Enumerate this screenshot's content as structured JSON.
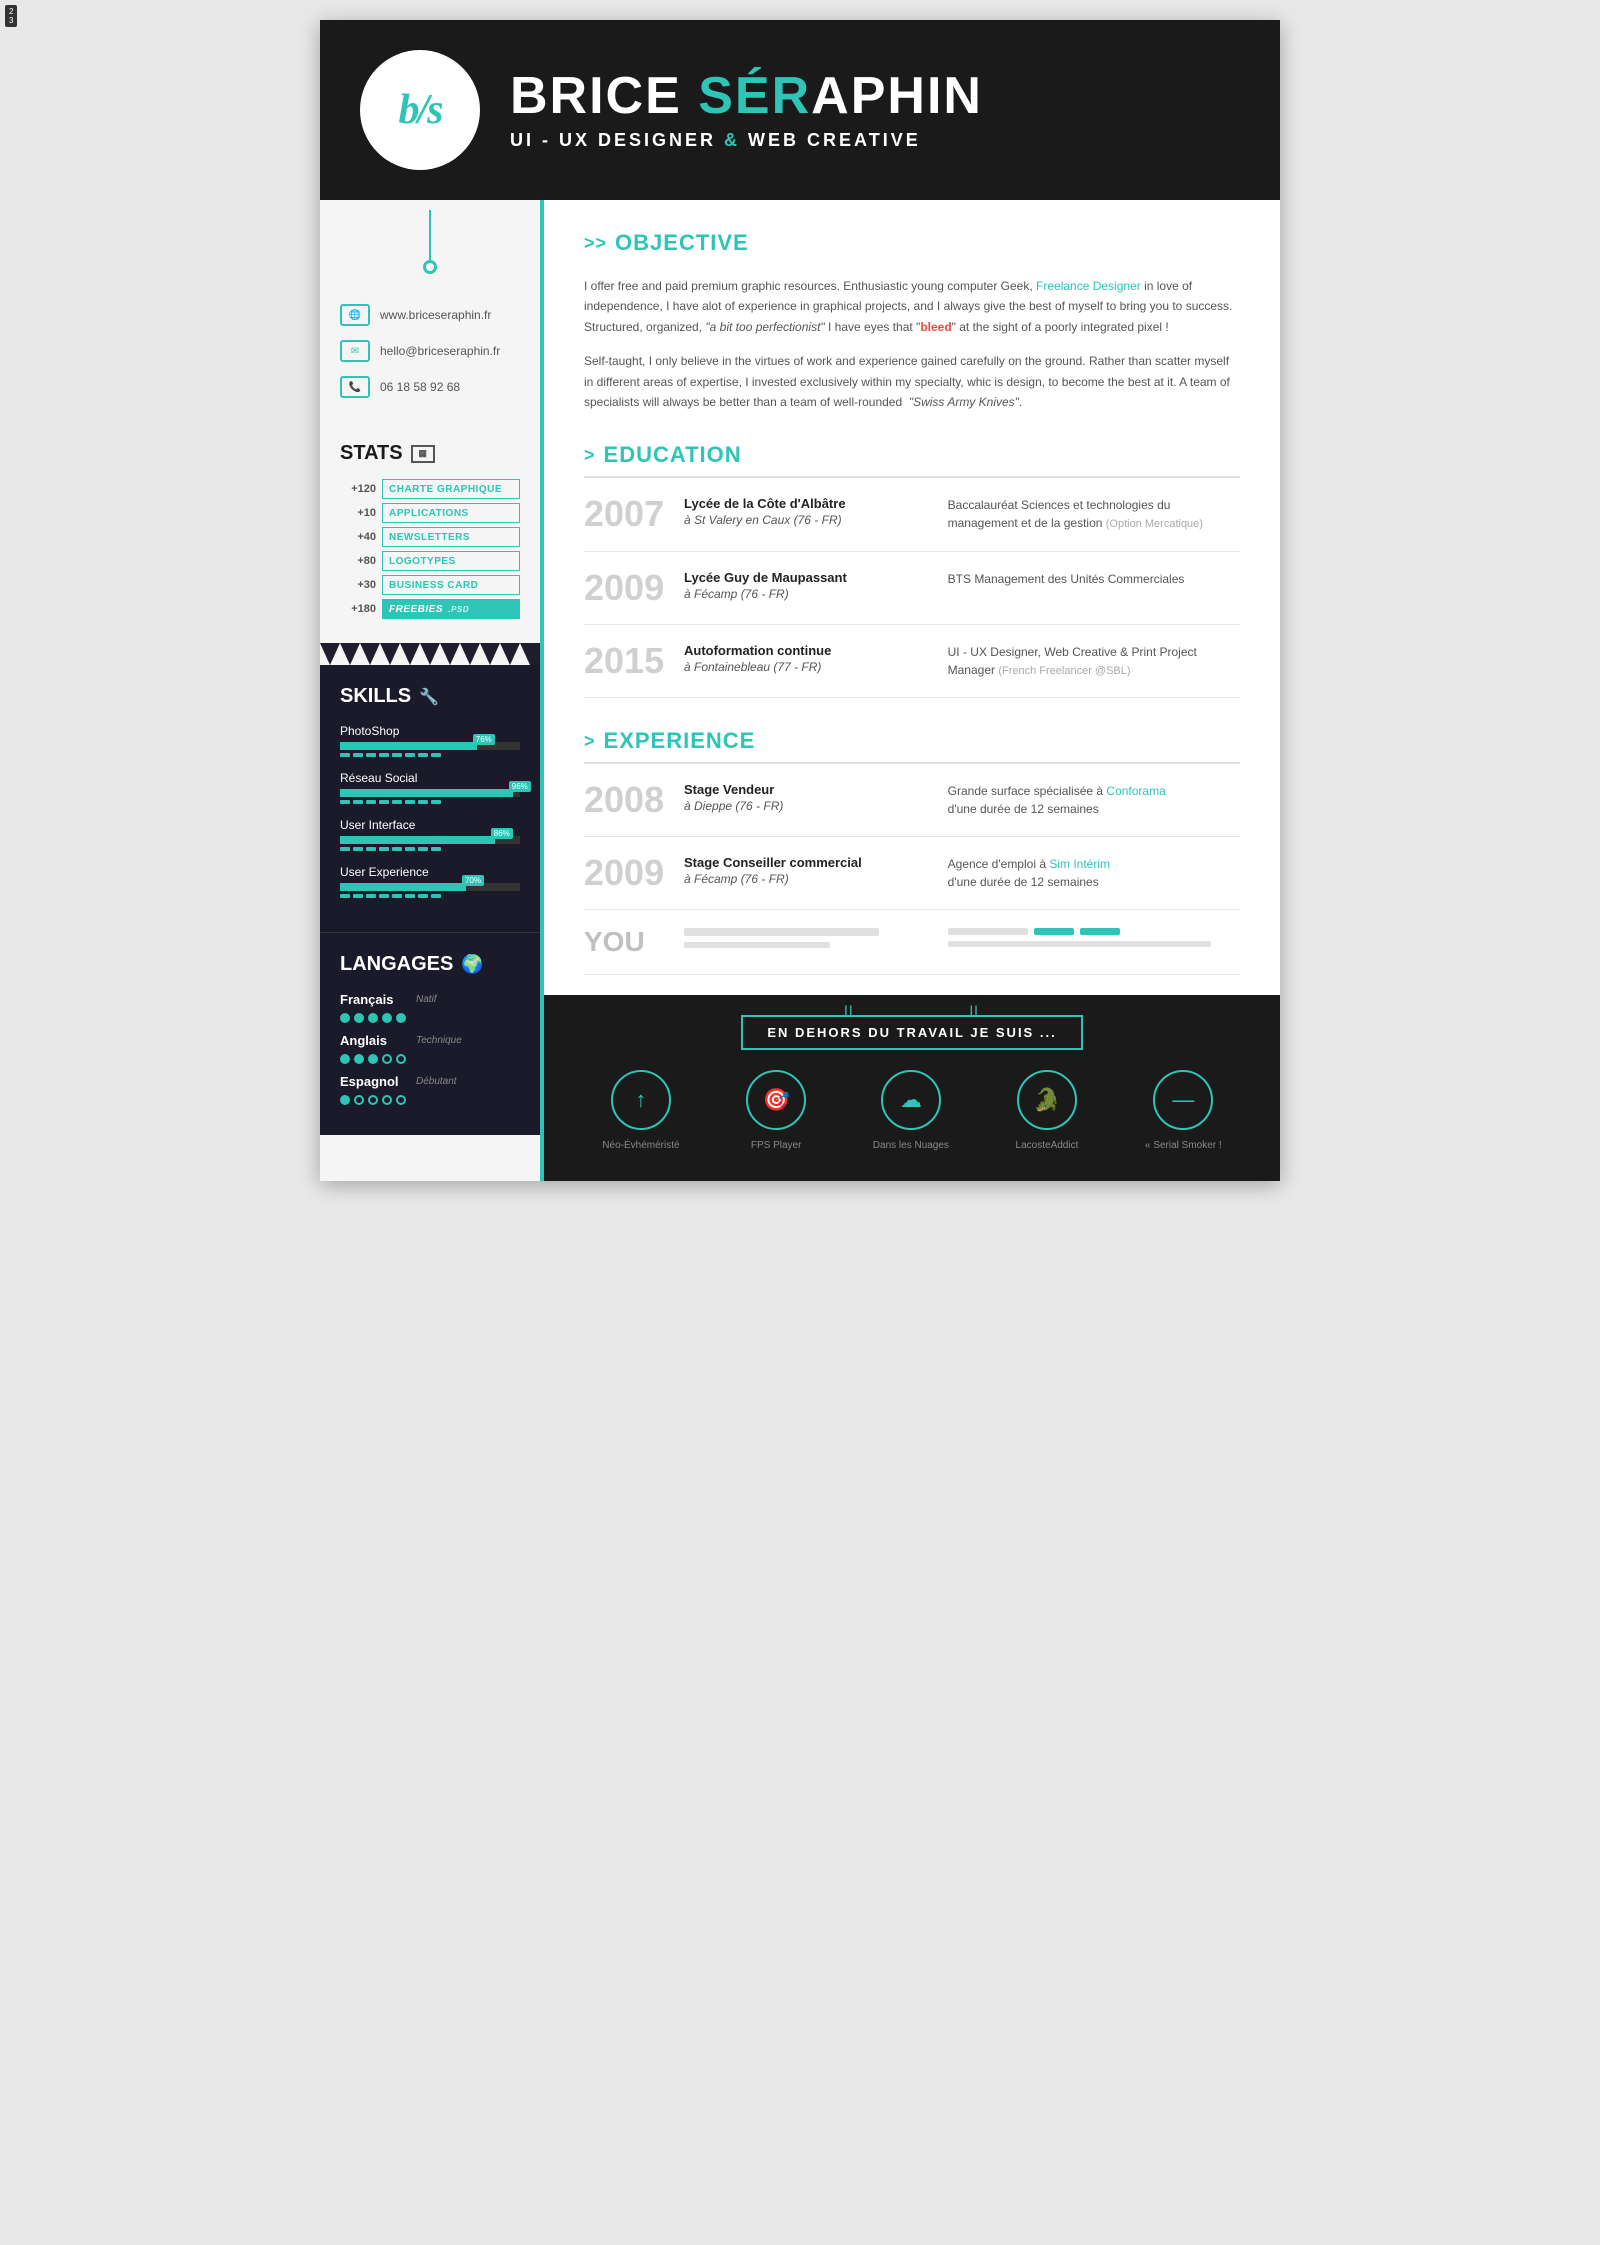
{
  "page": {
    "indicator": "2\n3"
  },
  "header": {
    "logo": "b/s",
    "name_part1": "BRICE ",
    "name_part2_teal": "SÉR",
    "name_part3": "APHIN",
    "subtitle": "UI - UX DESIGNER ",
    "subtitle_amp": "&",
    "subtitle_end": " WEB CREATIVE"
  },
  "sidebar": {
    "contact": {
      "website": "www.briceseraphin.fr",
      "email": "hello@briceseraphin.fr",
      "phone": "06 18 58 92 68"
    },
    "stats": {
      "title": "STATS",
      "items": [
        {
          "num": "+120",
          "label": "CHARTE GRAPHIQUE"
        },
        {
          "num": "+10",
          "label": "APPLICATIONS"
        },
        {
          "num": "+40",
          "label": "NEWSLETTERS"
        },
        {
          "num": "+80",
          "label": "LOGOTYPES"
        },
        {
          "num": "+30",
          "label": "BUSINESS CARD"
        },
        {
          "num": "+180",
          "label": "FREEBIES",
          "sub": ".PSD",
          "highlight": true
        }
      ]
    },
    "skills": {
      "title": "SKILLS",
      "items": [
        {
          "name": "PhotoShop",
          "pct": 76,
          "dots": 8
        },
        {
          "name": "Réseau Social",
          "pct": 96,
          "dots": 8
        },
        {
          "name": "User Interface",
          "pct": 86,
          "dots": 8
        },
        {
          "name": "User Experience",
          "pct": 70,
          "dots": 8
        }
      ]
    },
    "languages": {
      "title": "LANGAGES",
      "items": [
        {
          "name": "Français",
          "level": "Natif",
          "filled": 5,
          "total": 5
        },
        {
          "name": "Anglais",
          "level": "Technique",
          "filled": 3,
          "total": 5
        },
        {
          "name": "Espagnol",
          "level": "Débutant",
          "filled": 1,
          "total": 5
        }
      ]
    }
  },
  "content": {
    "objective": {
      "section_title": "OBJECTIVE",
      "p1": "I offer free and paid premium graphic resources. Enthusiastic young computer Geek, Freelance Designer in love of independence, I have alot of experience in graphical projects, and I always give the best of myself to bring you to success. Structured, organized, \"a bit too perfectionist\" I have eyes that \"bleed\" at the sight of a poorly integrated pixel !",
      "p1_teal": "Freelance Designer",
      "p1_italic": "\"a bit too perfectionist\"",
      "p1_red": "bleed",
      "p2": "Self-taught, I only believe in the virtues of work and experience gained carefully on the ground. Rather than scatter myself in different areas of expertise, I invested exclusively within my specialty, whic is design, to become the best at it. A team of specialists will always be better than a team of well-rounded  \"Swiss Army Knives\"."
    },
    "education": {
      "section_title": "EDUCATION",
      "entries": [
        {
          "year": "2007",
          "title": "Lycée de la Côte d'Albâtre",
          "location": "à St Valery en Caux (76 - FR)",
          "desc": "Baccalauréat Sciences et technologies du management et de la gestion",
          "desc_muted": "(Option Mercatique)"
        },
        {
          "year": "2009",
          "title": "Lycée Guy de Maupassant",
          "location": "à Fécamp (76 - FR)",
          "desc": "BTS Management des Unités Commerciales",
          "desc_muted": ""
        },
        {
          "year": "2015",
          "title": "Autoformation continue",
          "location": "à Fontainebleau (77 - FR)",
          "desc": "UI - UX Designer, Web Creative & Print Project Manager",
          "desc_muted": "(French Freelancer @SBL)"
        }
      ]
    },
    "experience": {
      "section_title": "EXPERIENCE",
      "entries": [
        {
          "year": "2008",
          "title": "Stage Vendeur",
          "location": "à Dieppe (76 - FR)",
          "desc": "Grande surface spécialisée à",
          "desc_teal": "Conforama",
          "desc_end": "d'une durée de 12 semaines"
        },
        {
          "year": "2009",
          "title": "Stage Conseiller commercial",
          "location": "à Fécamp (76 - FR)",
          "desc": "Agence d'emploi à",
          "desc_teal": "Sim Intérim",
          "desc_end": "d'une durée de 12 semaines"
        },
        {
          "year": "YOU",
          "title": "",
          "location": "",
          "desc": ""
        }
      ]
    },
    "outside": {
      "title": "EN DEHORS DU TRAVAIL JE SUIS ...",
      "items": [
        {
          "label": "Néo-Évhéméristé",
          "icon": "🎮"
        },
        {
          "label": "FPS Player",
          "icon": "🎯"
        },
        {
          "label": "Dans les Nuages",
          "icon": "☁"
        },
        {
          "label": "LacosteAddict",
          "icon": "🐊"
        },
        {
          "label": "« Serial Smoker !",
          "icon": "—"
        }
      ]
    }
  }
}
